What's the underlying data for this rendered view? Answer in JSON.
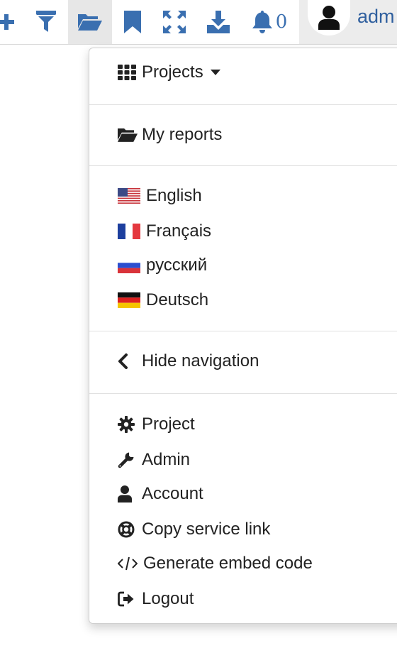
{
  "toolbar": {
    "icons": [
      "plus-icon",
      "filter-icon",
      "folder-open-icon",
      "bookmark-icon",
      "expand-icon",
      "download-icon",
      "bell-icon"
    ],
    "notification_count": "0",
    "username": "adm",
    "accent": "#3a6fb0"
  },
  "menu": {
    "projects_label": "Projects",
    "my_reports_label": "My reports",
    "languages": [
      {
        "label": "English",
        "flag": "us-flag"
      },
      {
        "label": "Français",
        "flag": "fr-flag"
      },
      {
        "label": "русский",
        "flag": "ru-flag"
      },
      {
        "label": "Deutsch",
        "flag": "de-flag"
      }
    ],
    "hide_navigation_label": "Hide navigation",
    "actions": [
      {
        "label": "Project",
        "icon": "gear-icon"
      },
      {
        "label": "Admin",
        "icon": "wrench-icon"
      },
      {
        "label": "Account",
        "icon": "user-icon"
      },
      {
        "label": "Copy service link",
        "icon": "life-ring-icon"
      },
      {
        "label": "Generate embed code",
        "icon": "code-icon"
      },
      {
        "label": "Logout",
        "icon": "sign-out-icon"
      }
    ]
  }
}
